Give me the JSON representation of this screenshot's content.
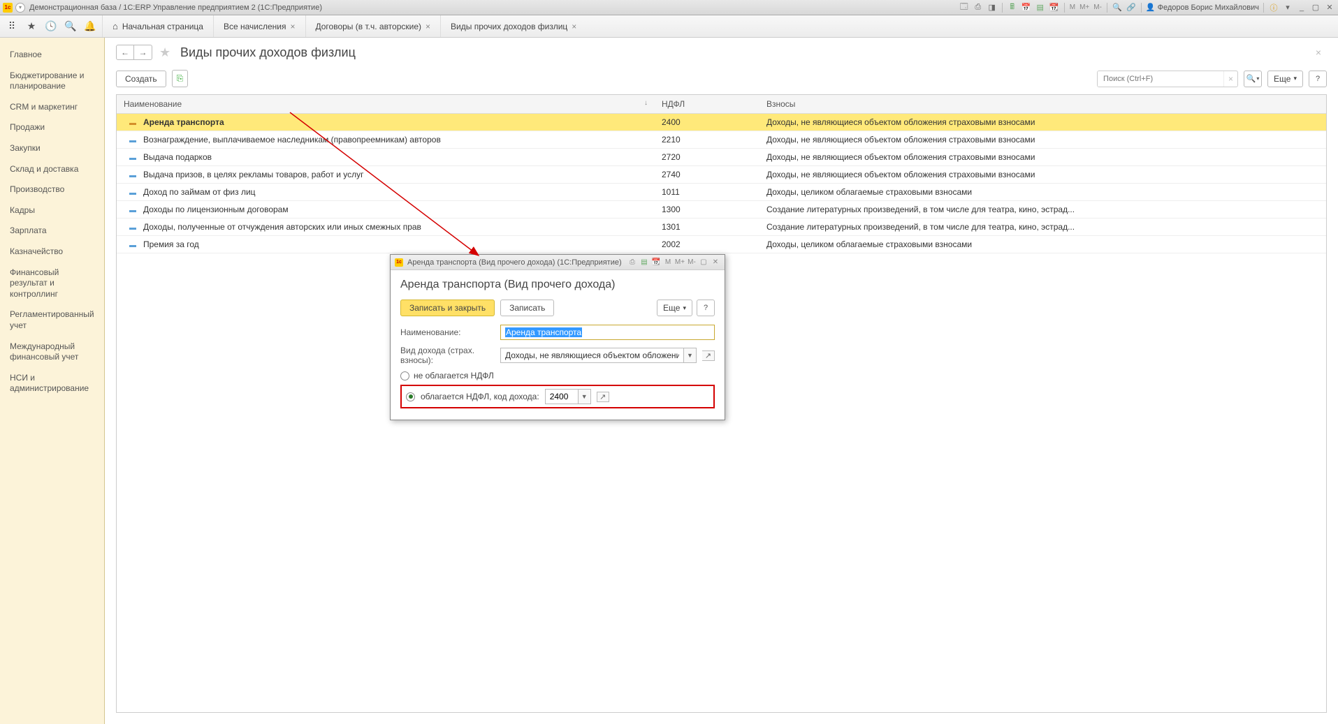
{
  "titlebar": {
    "title": "Демонстрационная база / 1С:ERP Управление предприятием 2  (1С:Предприятие)",
    "user": "Федоров Борис Михайлович",
    "m": [
      "M",
      "M+",
      "M-"
    ]
  },
  "tabs": {
    "home": "Начальная страница",
    "items": [
      {
        "label": "Все начисления",
        "close": true
      },
      {
        "label": "Договоры (в т.ч. авторские)",
        "close": true
      },
      {
        "label": "Виды прочих доходов физлиц",
        "close": true
      }
    ]
  },
  "sidebar": {
    "items": [
      "Главное",
      "Бюджетирование и планирование",
      "CRM и маркетинг",
      "Продажи",
      "Закупки",
      "Склад и доставка",
      "Производство",
      "Кадры",
      "Зарплата",
      "Казначейство",
      "Финансовый результат и контроллинг",
      "Регламентированный учет",
      "Международный финансовый учет",
      "НСИ и администрирование"
    ]
  },
  "page": {
    "title": "Виды прочих доходов физлиц",
    "toolbar": {
      "create": "Создать",
      "more": "Еще",
      "search_placeholder": "Поиск (Ctrl+F)"
    },
    "columns": {
      "name": "Наименование",
      "ndfl": "НДФЛ",
      "vznosy": "Взносы"
    },
    "rows": [
      {
        "name": "Аренда транспорта",
        "ndfl": "2400",
        "vznosy": "Доходы, не являющиеся объектом обложения страховыми взносами",
        "selected": true
      },
      {
        "name": "Вознаграждение, выплачиваемое наследникам (правопреемникам) авторов",
        "ndfl": "2210",
        "vznosy": "Доходы, не являющиеся объектом обложения страховыми взносами"
      },
      {
        "name": "Выдача подарков",
        "ndfl": "2720",
        "vznosy": "Доходы, не являющиеся объектом обложения страховыми взносами"
      },
      {
        "name": "Выдача призов, в целях рекламы товаров, работ и услуг",
        "ndfl": "2740",
        "vznosy": "Доходы, не являющиеся объектом обложения страховыми взносами"
      },
      {
        "name": "Доход по займам от физ лиц",
        "ndfl": "1011",
        "vznosy": "Доходы, целиком облагаемые страховыми взносами"
      },
      {
        "name": "Доходы по лицензионным договорам",
        "ndfl": "1300",
        "vznosy": "Создание литературных произведений, в том числе для театра, кино, эстрад..."
      },
      {
        "name": "Доходы, полученные от отчуждения авторских или иных смежных прав",
        "ndfl": "1301",
        "vznosy": "Создание литературных произведений, в том числе для театра, кино, эстрад..."
      },
      {
        "name": "Премия за год",
        "ndfl": "2002",
        "vznosy": "Доходы, целиком облагаемые страховыми взносами"
      }
    ]
  },
  "dialog": {
    "bar_title": "Аренда транспорта (Вид прочего дохода)  (1С:Предприятие)",
    "title": "Аренда транспорта (Вид прочего дохода)",
    "save_close": "Записать и закрыть",
    "save": "Записать",
    "more": "Еще",
    "name_label": "Наименование:",
    "name_value": "Аренда транспорта",
    "kind_label": "Вид дохода (страх. взносы):",
    "kind_value": "Доходы, не являющиеся объектом обложения страховым",
    "radio_off": "не облагается НДФЛ",
    "radio_on": "облагается НДФЛ, код дохода:",
    "code": "2400"
  }
}
